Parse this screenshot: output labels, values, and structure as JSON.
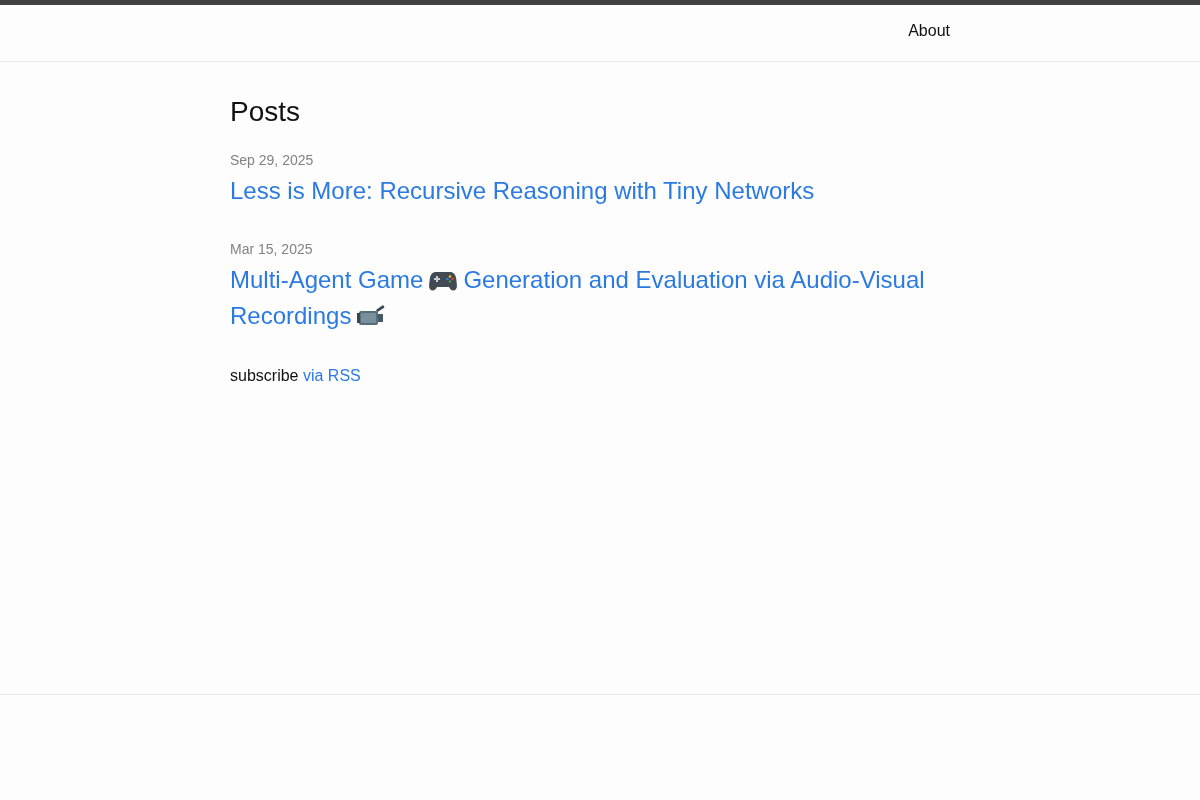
{
  "header": {
    "nav_links": [
      {
        "label": "About"
      }
    ]
  },
  "main": {
    "heading": "Posts",
    "posts": [
      {
        "date": "Sep 29, 2025",
        "title": [
          {
            "kind": "text",
            "text": "Less is More: Recursive Reasoning with Tiny Networks"
          }
        ]
      },
      {
        "date": "Mar 15, 2025",
        "title": [
          {
            "kind": "text",
            "text": "Multi-Agent Game"
          },
          {
            "kind": "gamepad"
          },
          {
            "kind": "text",
            "text": "Generation and Evaluation via Audio-Visual Recordings"
          },
          {
            "kind": "camcorder"
          }
        ]
      }
    ],
    "subscribe": {
      "text": "subscribe",
      "link": "via RSS"
    }
  }
}
